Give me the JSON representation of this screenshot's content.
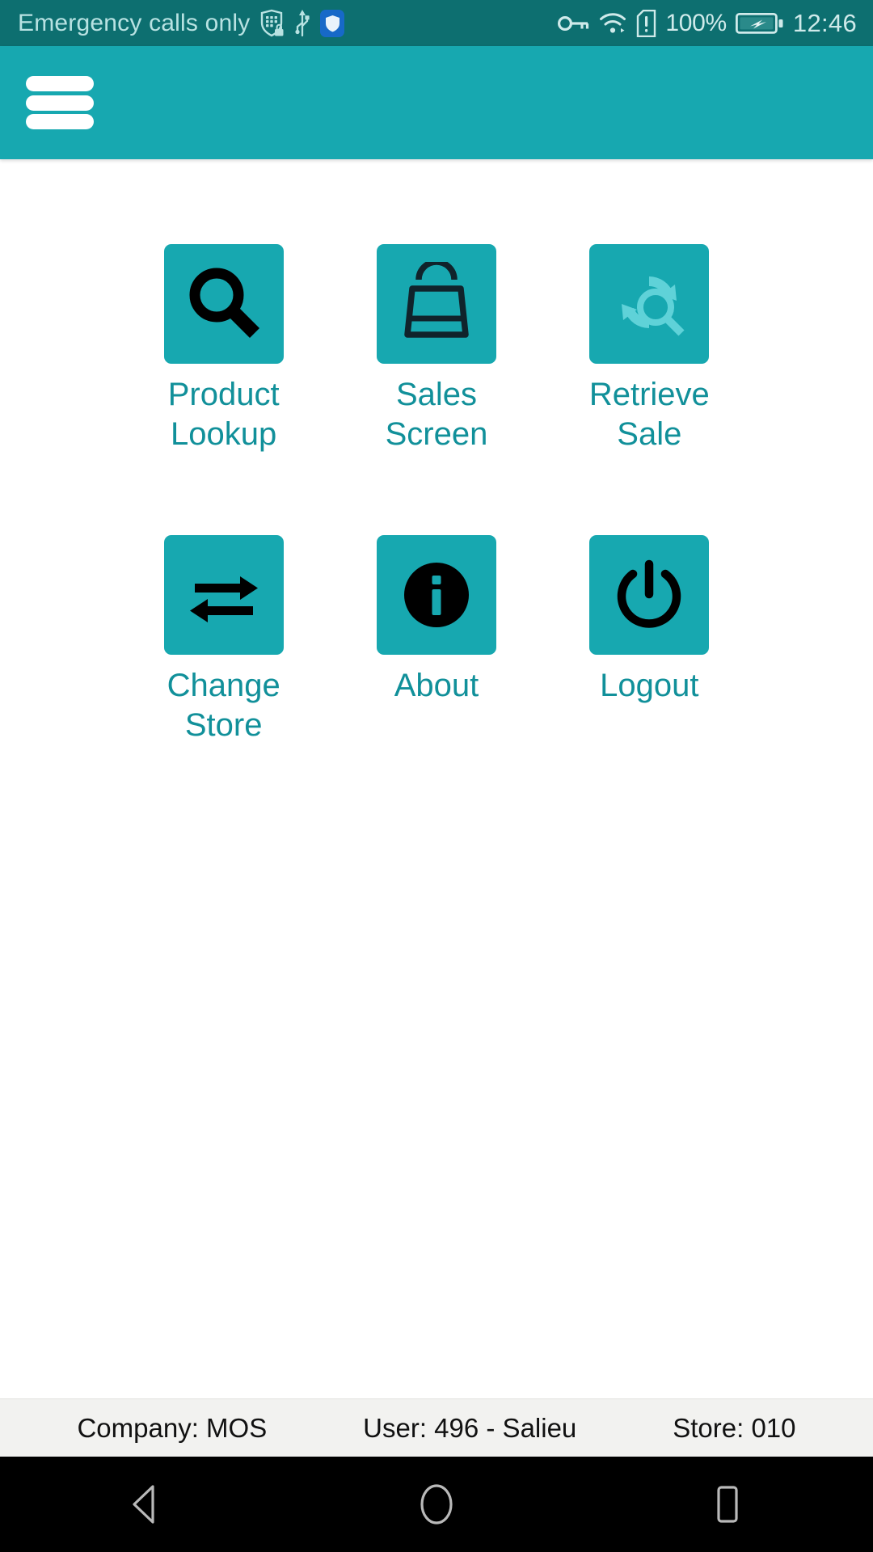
{
  "status_bar": {
    "carrier_text": "Emergency calls only",
    "battery_percent": "100%",
    "clock": "12:46",
    "left_icons": [
      "keypad-shield-lock-icon",
      "usb-icon",
      "security-shield-app-icon"
    ],
    "right_icons": [
      "vpn-key-icon",
      "wifi-icon",
      "sim-alert-icon",
      "battery-charging-icon"
    ],
    "background_color": "#0d6f70",
    "text_color": "#b8e2e2"
  },
  "app_bar": {
    "menu_icon": "hamburger-menu-icon",
    "background_color": "#17a8b0"
  },
  "main": {
    "accent_color": "#17a8b0",
    "label_color": "#11909a",
    "tiles": [
      {
        "id": "product-lookup",
        "label": "Product\nLookup",
        "icon": "magnifier-icon",
        "icon_style": "dark"
      },
      {
        "id": "sales-screen",
        "label": "Sales\nScreen",
        "icon": "shopping-bag-icon",
        "icon_style": "dark"
      },
      {
        "id": "retrieve-sale",
        "label": "Retrieve\nSale",
        "icon": "refresh-search-icon",
        "icon_style": "light"
      },
      {
        "id": "change-store",
        "label": "Change\nStore",
        "icon": "swap-arrows-icon",
        "icon_style": "dark"
      },
      {
        "id": "about",
        "label": "About",
        "icon": "info-circle-icon",
        "icon_style": "dark"
      },
      {
        "id": "logout",
        "label": "Logout",
        "icon": "power-icon",
        "icon_style": "dark"
      }
    ]
  },
  "footer": {
    "company": "Company: MOS",
    "user": "User: 496 - Salieu",
    "store": "Store: 010",
    "background_color": "#f2f2f0"
  },
  "nav_bar": {
    "back": "back-triangle-icon",
    "home": "home-circle-icon",
    "recents": "recents-square-icon",
    "background_color": "#000000"
  }
}
